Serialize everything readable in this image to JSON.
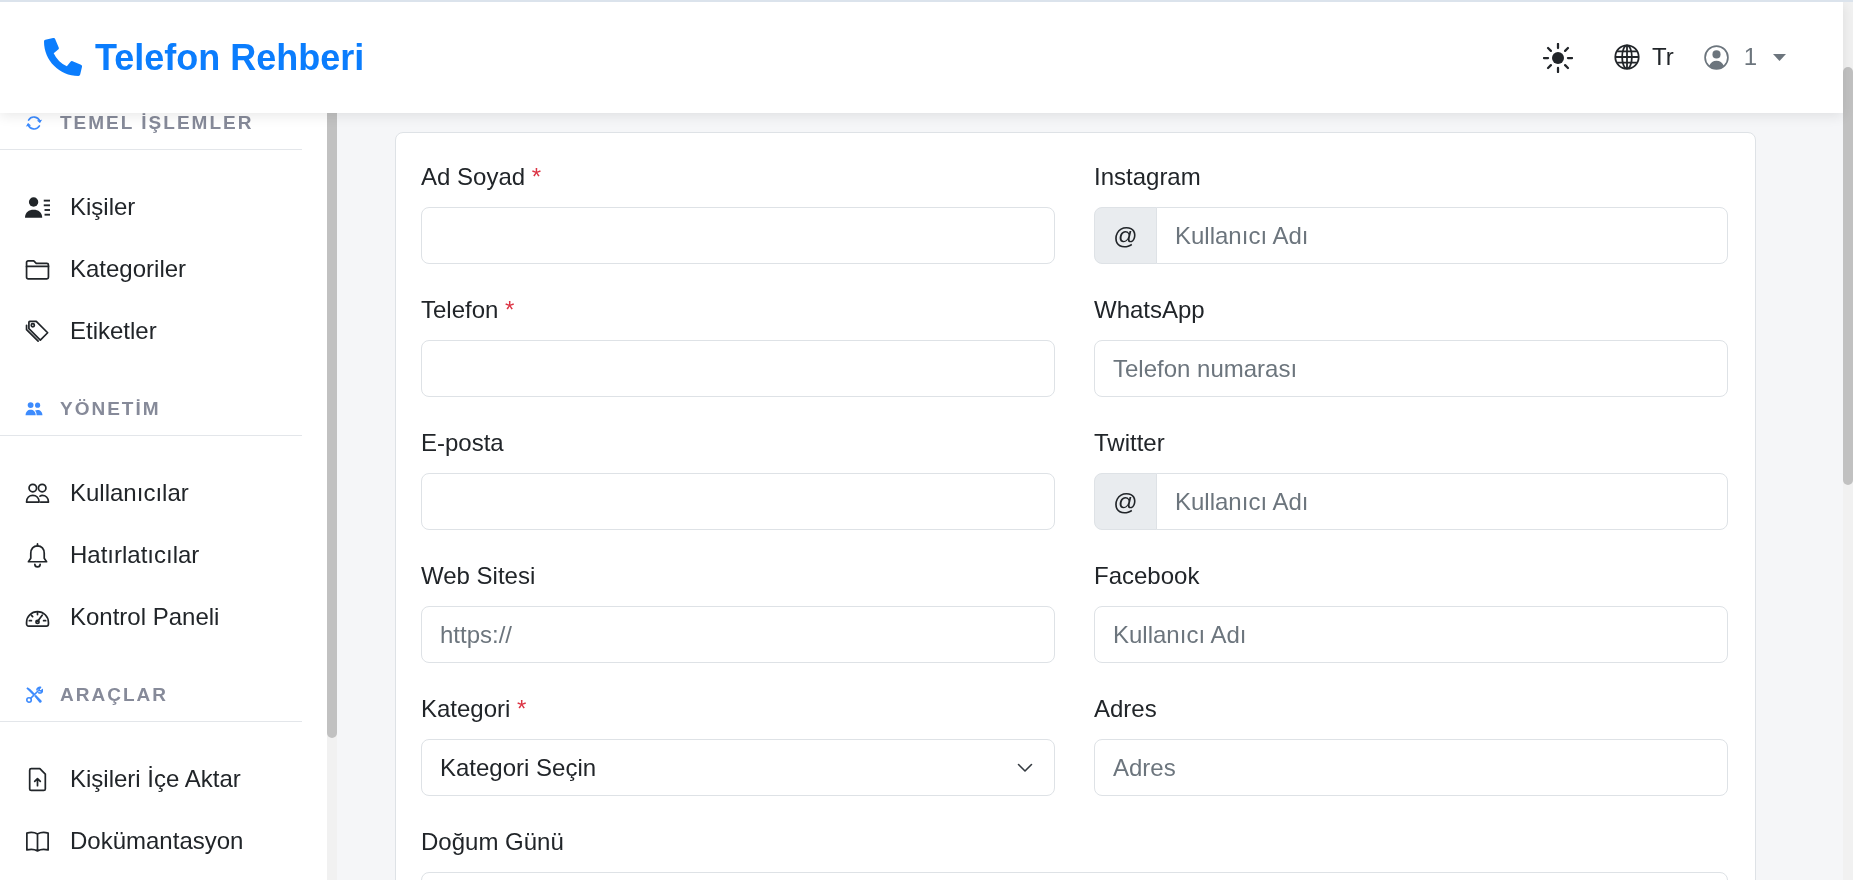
{
  "header": {
    "brand": "Telefon Rehberi",
    "language": "Tr",
    "user": "1"
  },
  "sidebar": {
    "sections": [
      {
        "title": "TEMEL İŞLEMLER",
        "items": [
          {
            "label": "Kişiler",
            "selected": false
          },
          {
            "label": "Kategoriler",
            "selected": false
          },
          {
            "label": "Etiketler",
            "selected": false
          }
        ]
      },
      {
        "title": "YÖNETİM",
        "items": [
          {
            "label": "Kullanıcılar",
            "selected": false
          },
          {
            "label": "Hatırlatıcılar",
            "selected": false
          },
          {
            "label": "Kontrol Paneli",
            "selected": false
          }
        ]
      },
      {
        "title": "ARAÇLAR",
        "items": [
          {
            "label": "Kişileri İçe Aktar",
            "selected": false
          },
          {
            "label": "Dokümantasyon",
            "selected": false
          }
        ]
      }
    ]
  },
  "form": {
    "columns": [
      {
        "fields": [
          {
            "kind": "text",
            "label": "Ad Soyad",
            "required_mark": "*"
          },
          {
            "kind": "text",
            "label": "Telefon",
            "required_mark": "*"
          },
          {
            "kind": "text",
            "label": "E-posta"
          },
          {
            "kind": "text",
            "label": "Web Sitesi",
            "placeholder": "https://"
          },
          {
            "kind": "select",
            "label": "Kategori",
            "required_mark": "*",
            "value": "Kategori Seçin"
          }
        ]
      },
      {
        "fields": [
          {
            "kind": "text",
            "label": "Instagram",
            "prefix": "@",
            "placeholder": "Kullanıcı Adı"
          },
          {
            "kind": "text",
            "label": "WhatsApp",
            "placeholder": "Telefon numarası"
          },
          {
            "kind": "text",
            "label": "Twitter",
            "prefix": "@",
            "placeholder": "Kullanıcı Adı"
          },
          {
            "kind": "text",
            "label": "Facebook",
            "placeholder": "Kullanıcı Adı"
          },
          {
            "kind": "text",
            "label": "Adres",
            "placeholder": "Adres"
          }
        ]
      }
    ],
    "full_width": [
      {
        "kind": "date",
        "label": "Doğum Günü"
      }
    ]
  }
}
